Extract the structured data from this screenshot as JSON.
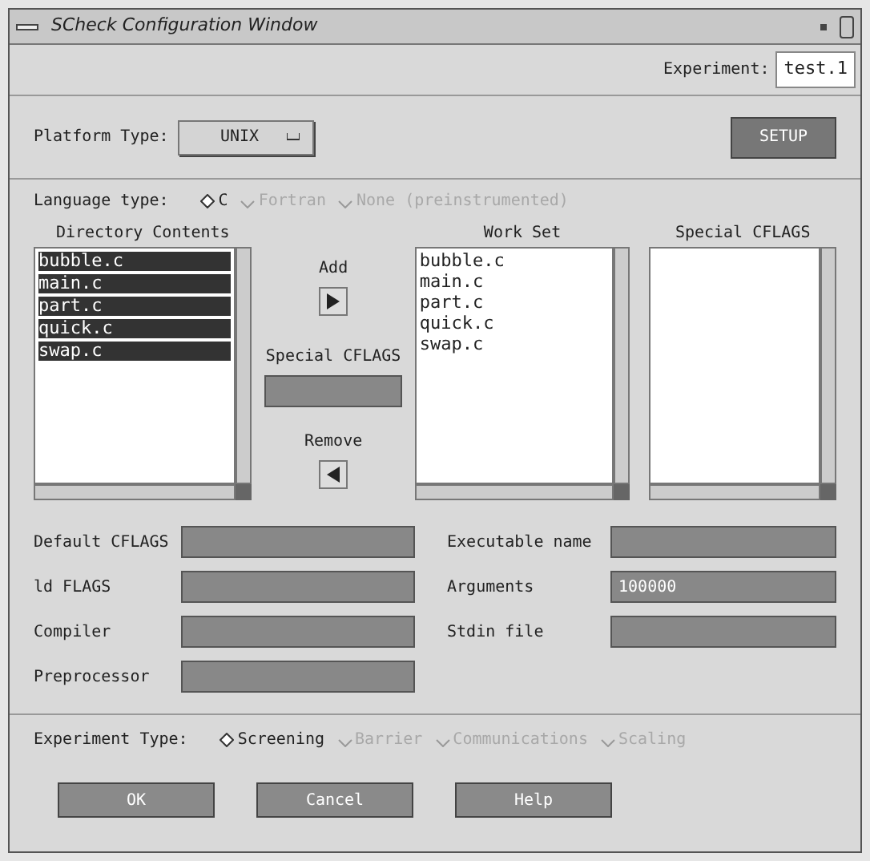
{
  "window": {
    "title": "SCheck Configuration Window"
  },
  "experiment": {
    "label": "Experiment:",
    "value": "test.1"
  },
  "platform": {
    "label": "Platform Type:",
    "value": "UNIX"
  },
  "setup_button": "SETUP",
  "language": {
    "label": "Language type:",
    "options": [
      {
        "label": "C",
        "selected": true,
        "disabled": false
      },
      {
        "label": "Fortran",
        "selected": false,
        "disabled": true
      },
      {
        "label": "None (preinstrumented)",
        "selected": false,
        "disabled": true
      }
    ]
  },
  "directory_contents": {
    "title": "Directory Contents",
    "items": [
      {
        "label": "bubble.c",
        "selected": true
      },
      {
        "label": "main.c",
        "selected": true
      },
      {
        "label": "part.c",
        "selected": true
      },
      {
        "label": "quick.c",
        "selected": true
      },
      {
        "label": "swap.c",
        "selected": true
      }
    ]
  },
  "transfer": {
    "add_label": "Add",
    "special_label": "Special CFLAGS",
    "remove_label": "Remove"
  },
  "work_set": {
    "title": "Work Set",
    "items": [
      "bubble.c",
      "main.c",
      "part.c",
      "quick.c",
      "swap.c"
    ]
  },
  "special_cflags": {
    "title": "Special CFLAGS"
  },
  "fields_left": [
    {
      "label": "Default CFLAGS"
    },
    {
      "label": "ld FLAGS"
    },
    {
      "label": "Compiler"
    },
    {
      "label": "Preprocessor"
    }
  ],
  "fields_right": [
    {
      "label": "Executable name"
    },
    {
      "label": "Arguments",
      "value": "100000"
    },
    {
      "label": "Stdin file"
    }
  ],
  "experiment_type": {
    "label": "Experiment Type:",
    "options": [
      {
        "label": "Screening",
        "selected": true,
        "disabled": false
      },
      {
        "label": "Barrier",
        "selected": false,
        "disabled": true
      },
      {
        "label": "Communications",
        "selected": false,
        "disabled": true
      },
      {
        "label": "Scaling",
        "selected": false,
        "disabled": true
      }
    ]
  },
  "buttons": [
    "OK",
    "Cancel",
    "Help"
  ]
}
